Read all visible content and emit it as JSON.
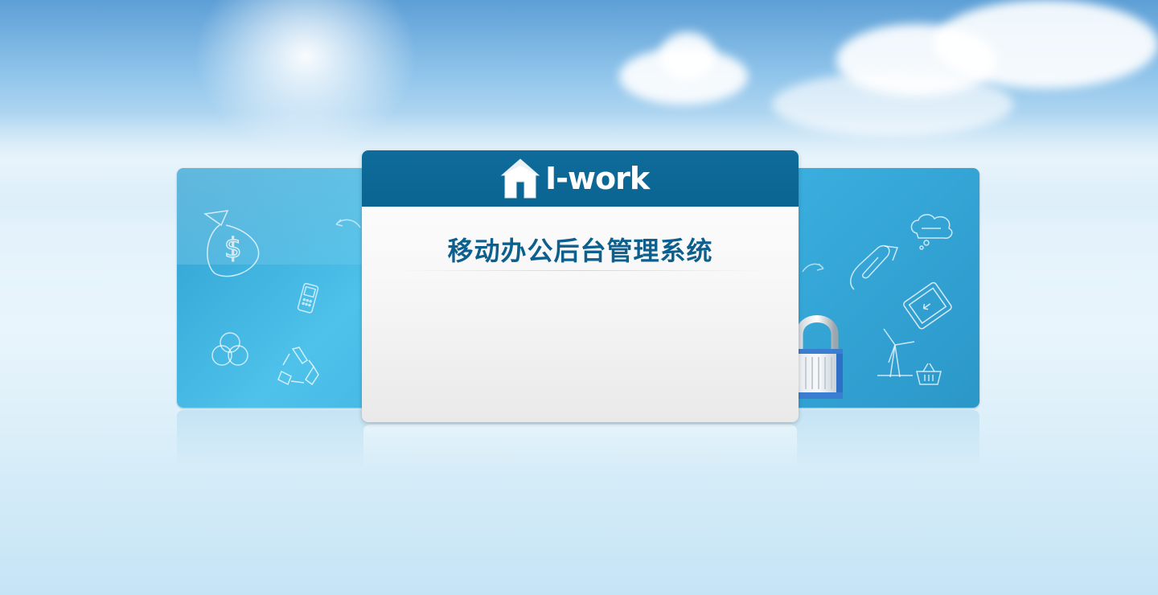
{
  "brand": {
    "logo_text": "I-work",
    "logo_icon": "house-icon"
  },
  "login_card": {
    "title": "移动办公后台管理系统"
  },
  "decorations": {
    "left_icons": [
      "money-bag-icon",
      "phone-icon",
      "arrow-icon",
      "circles-icon",
      "recycle-icon"
    ],
    "right_icons": [
      "cloud-chat-icon",
      "paperclip-icon",
      "arrow-icon",
      "tablet-icon",
      "windmill-icon",
      "basket-icon",
      "padlock-icon"
    ]
  },
  "colors": {
    "header_blue": "#0a6592",
    "title_blue": "#0d5f8e",
    "panel_blue": "#3aaede"
  }
}
